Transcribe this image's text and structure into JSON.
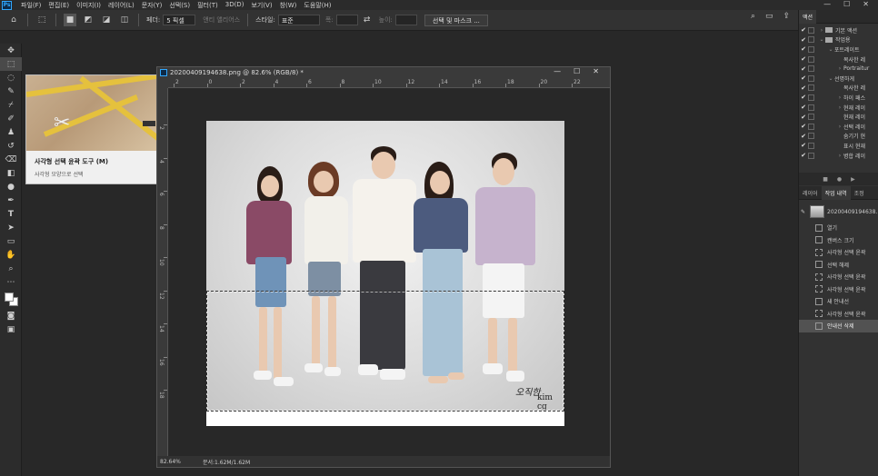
{
  "menubar": {
    "logo": "Ps",
    "items": [
      "파일(F)",
      "편집(E)",
      "이미지(I)",
      "레이어(L)",
      "문자(Y)",
      "선택(S)",
      "필터(T)",
      "3D(D)",
      "보기(V)",
      "창(W)",
      "도움말(H)"
    ],
    "win_minimize": "—",
    "win_maximize": "☐",
    "win_close": "✕"
  },
  "options": {
    "feather_label": "페더:",
    "feather_value": "5 픽셀",
    "antialias_label": "앤티 앨리어스",
    "style_label": "스타일:",
    "style_value": "표준",
    "width_label": "폭:",
    "height_label": "높이:",
    "select_mask_button": "선택 및 마스크 ..."
  },
  "tooltip": {
    "title": "사각형 선택 윤곽 도구 (M)",
    "desc": "사각형 모양으로 선택"
  },
  "document": {
    "title": "20200409194638.png @ 82.6% (RGB/8) *",
    "ruler_h": [
      "2",
      "0",
      "2",
      "4",
      "6",
      "8",
      "10",
      "12",
      "14",
      "16",
      "18",
      "20",
      "22"
    ],
    "ruler_v": [
      "2",
      "4",
      "6",
      "8",
      "10",
      "12",
      "14",
      "16",
      "18"
    ],
    "signature": "오직한",
    "signature_name": "kim cg",
    "zoom": "82.64%",
    "doc_info": "문서:1.62M/1.62M"
  },
  "actions_panel": {
    "tab": "액션",
    "rows": [
      {
        "indent": 0,
        "arrow": "›",
        "folder": true,
        "label": "기본 액션"
      },
      {
        "indent": 0,
        "arrow": "⌄",
        "folder": true,
        "label": "작업용"
      },
      {
        "indent": 1,
        "arrow": "⌄",
        "folder": false,
        "label": "포트레이트"
      },
      {
        "indent": 2,
        "arrow": "",
        "folder": false,
        "label": "복사한 레"
      },
      {
        "indent": 2,
        "arrow": "›",
        "folder": false,
        "label": "Portraitur"
      },
      {
        "indent": 1,
        "arrow": "⌄",
        "folder": false,
        "label": "선명하게"
      },
      {
        "indent": 2,
        "arrow": "",
        "folder": false,
        "label": "복사한 레"
      },
      {
        "indent": 2,
        "arrow": "›",
        "folder": false,
        "label": "하이 패스"
      },
      {
        "indent": 2,
        "arrow": "›",
        "folder": false,
        "label": "현재 레이"
      },
      {
        "indent": 2,
        "arrow": "",
        "folder": false,
        "label": "현재 레이"
      },
      {
        "indent": 2,
        "arrow": "›",
        "folder": false,
        "label": "선택 레이"
      },
      {
        "indent": 2,
        "arrow": "",
        "folder": false,
        "label": "숨기기 현"
      },
      {
        "indent": 2,
        "arrow": "",
        "folder": false,
        "label": "표시 현재"
      },
      {
        "indent": 2,
        "arrow": "›",
        "folder": false,
        "label": "병합 레이"
      }
    ],
    "footer": [
      "■",
      "●",
      "▶"
    ]
  },
  "layers_tabs": [
    "레이어",
    "작업 내역",
    "조정"
  ],
  "history": {
    "snapshot": "20200409194638.",
    "rows": [
      {
        "label": "열기",
        "dashed": false,
        "active": false
      },
      {
        "label": "캔버스 크기",
        "dashed": false,
        "active": false
      },
      {
        "label": "사각형 선택 윤곽",
        "dashed": true,
        "active": false
      },
      {
        "label": "선택 해제",
        "dashed": false,
        "active": false
      },
      {
        "label": "사각형 선택 윤곽",
        "dashed": true,
        "active": false
      },
      {
        "label": "사각형 선택 윤곽",
        "dashed": true,
        "active": false
      },
      {
        "label": "새 안내선",
        "dashed": false,
        "active": false
      },
      {
        "label": "사각형 선택 윤곽",
        "dashed": true,
        "active": false
      },
      {
        "label": "안내선 삭제",
        "dashed": false,
        "active": true
      }
    ]
  },
  "colors": {
    "accent": "#31a8ff",
    "panel": "#323232",
    "canvas_bg": "#282828"
  }
}
